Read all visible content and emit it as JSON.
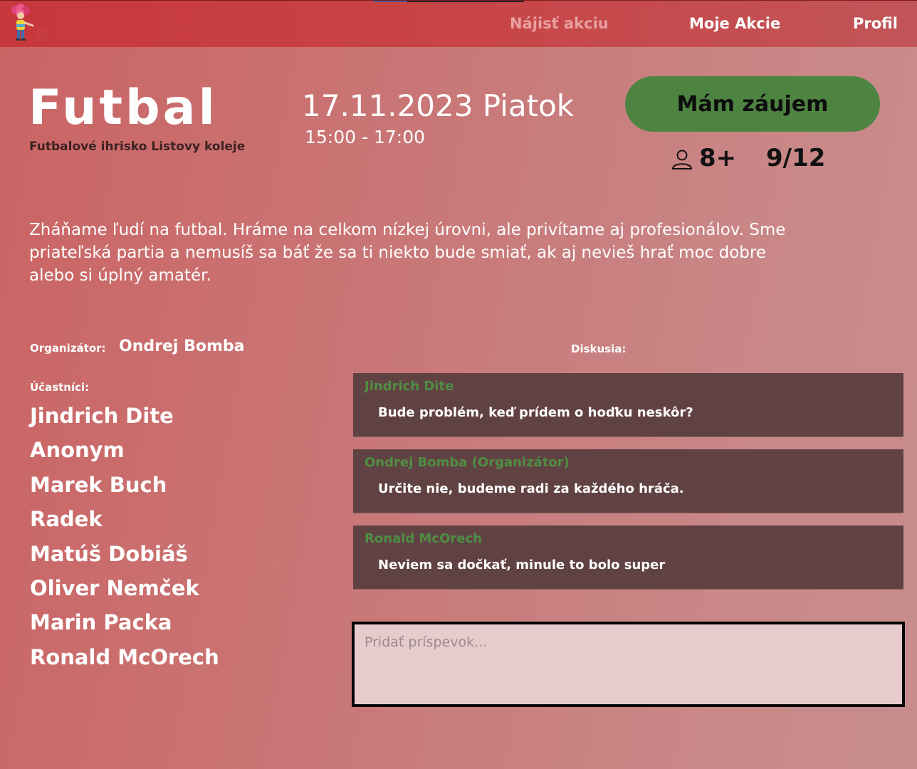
{
  "header": {
    "logo_icon": "cartoon-mascot-icon",
    "nav": {
      "find_label": "Nájisť akciu",
      "mine_label": "Moje Akcie",
      "profile_label": "Profil"
    }
  },
  "event": {
    "title": "Futbal",
    "location": "Futbalové ihrisko Listovy koleje",
    "date": "17.11.2023 Piatok",
    "time": "15:00 - 17:00",
    "interest_label": "Mám záujem",
    "age_icon": "person-icon",
    "age": "8+",
    "capacity": "9/12",
    "description": "Zháňame ľudí na futbal. Hráme na celkom nízkej úrovni, ale privítame aj profesionálov. Sme priateľská partia a nemusíš sa báť že sa ti niekto bude smiať, ak aj nevieš hrať moc dobre alebo si úplný amatér."
  },
  "organizer": {
    "label": "Organizátor:",
    "name": "Ondrej Bomba"
  },
  "participants": {
    "label": "Účastníci:",
    "names": [
      "Jindrich Dite",
      "Anonym",
      "Marek Buch",
      "Radek",
      "Matúš Dobiáš",
      "Oliver Nemček",
      "Marin Packa",
      "Ronald McOrech"
    ]
  },
  "discussion": {
    "label": "Diskusia:",
    "comments": [
      {
        "author": "Jindrich Dite",
        "text": "Bude problém, keď prídem o hoďku neskôr?"
      },
      {
        "author": "Ondrej Bomba (Organizátor)",
        "text": "Určite nie, budeme radi za každého hráča."
      },
      {
        "author": "Ronald McOrech",
        "text": "Neviem sa dočkať, minule to bolo super"
      }
    ],
    "input_placeholder": "Pridať príspevok..."
  },
  "colors": {
    "header": "#c7373c",
    "button_green": "#4e8442",
    "comment_bg": "#614243",
    "comment_author": "#4f8e43"
  }
}
